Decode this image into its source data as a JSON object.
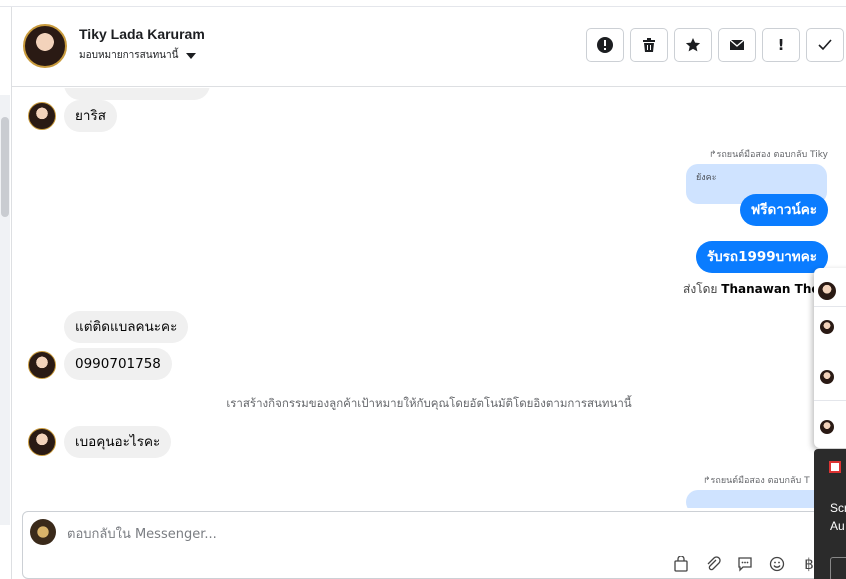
{
  "header": {
    "contact_name": "Tiky Lada Karuram",
    "assign_label": "มอบหมายการสนทนานี้",
    "actions": [
      {
        "name": "spam",
        "glyph": "!"
      },
      {
        "name": "delete",
        "glyph": "🗑"
      },
      {
        "name": "star",
        "glyph": "★"
      },
      {
        "name": "mark-unread",
        "glyph": "✉"
      },
      {
        "name": "follow-up",
        "glyph": "!"
      },
      {
        "name": "done",
        "glyph": "✓"
      }
    ]
  },
  "messages": {
    "in_1": "ยาริส",
    "reply_label_1": "↱รถยนต์มือสอง ตอบกลับ Tiky",
    "quote_1": "ยังคะ",
    "out_1": "ฟรีดาวน์คะ",
    "out_2": "รับรถ1999บาทคะ",
    "sent_by_prefix": "ส่งโดย",
    "sent_by_name": "Thanawan Thon",
    "in_2": "แต่ติดแบลคนะคะ",
    "in_3": "0990701758",
    "system_note": "เราสร้างกิจกรรมของลูกค้าเป้าหมายให้กับคุณโดยอัตโนมัติโดยอิงตามการสนทนานี้",
    "in_4": "เบอคุนอะไรคะ",
    "reply_label_2": "↱รถยนต์มือสอง ตอบกลับ T"
  },
  "composer": {
    "placeholder": "ตอบกลับใน Messenger...",
    "tools": [
      {
        "name": "shop",
        "glyph": "🛍"
      },
      {
        "name": "attach",
        "glyph": "📎"
      },
      {
        "name": "saved-replies",
        "glyph": "💬"
      },
      {
        "name": "emoji",
        "glyph": "☺"
      },
      {
        "name": "payment",
        "glyph": "฿"
      }
    ]
  },
  "overlay": {
    "line1": "Scr",
    "line2": "Au"
  }
}
